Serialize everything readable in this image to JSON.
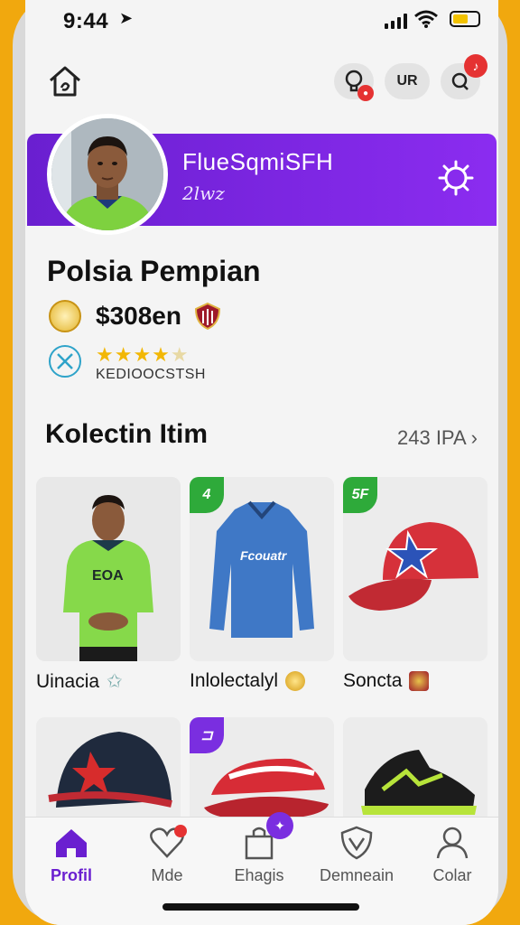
{
  "status_bar": {
    "time": "9:44",
    "location_glyph": "➤"
  },
  "top_nav": {
    "home_icon": "house-icon",
    "profile_initials": "UR"
  },
  "profile": {
    "banner_name": "FlueSqmiSFH",
    "banner_sub": "2lwz",
    "name": "Polsia Pempian",
    "balance": "$308en",
    "rating_stars": 4,
    "rating_label": "KEDIOOCSTSH"
  },
  "collection": {
    "title": "Kolectin Itim",
    "count_link": "243 IPA",
    "items": [
      {
        "label": "Uinacia",
        "tag": ""
      },
      {
        "label": "Inlolectalyl",
        "tag": "4"
      },
      {
        "label": "Soncta",
        "tag": "5F"
      },
      {
        "label": "",
        "tag": ""
      },
      {
        "label": "",
        "tag": ""
      },
      {
        "label": "",
        "tag": ""
      }
    ]
  },
  "tabs": [
    {
      "label": "Profil",
      "icon": "house-icon",
      "active": true
    },
    {
      "label": "Mde",
      "icon": "heart-icon",
      "active": false
    },
    {
      "label": "Ehagis",
      "icon": "bag-icon",
      "active": false
    },
    {
      "label": "Demneain",
      "icon": "shield-icon",
      "active": false
    },
    {
      "label": "Colar",
      "icon": "person-icon",
      "active": false
    }
  ],
  "colors": {
    "brand_purple": "#6a1fd0",
    "tag_green": "#2eaa3a",
    "star_gold": "#f2b705",
    "frame_yellow": "#F1A80E"
  }
}
